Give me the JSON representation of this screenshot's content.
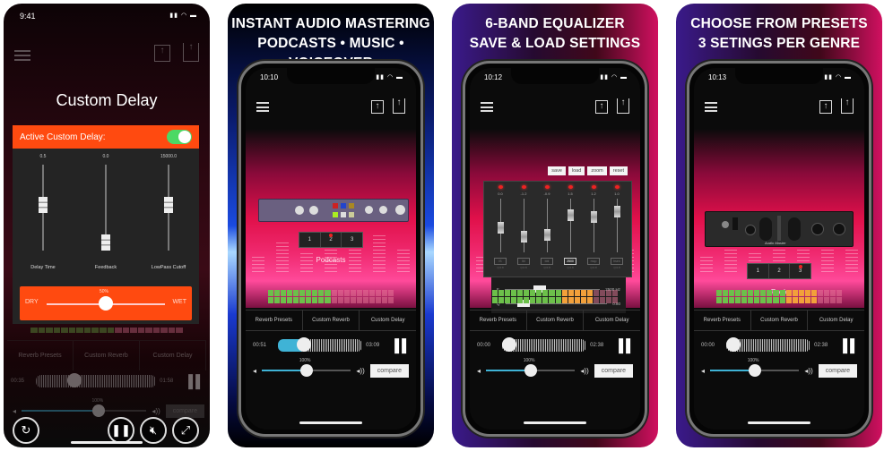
{
  "panels": [
    {
      "status_time": "9:41",
      "dialog_title": "Custom Delay",
      "active_label": "Active Custom Delay:",
      "active_on": true,
      "sliders": [
        {
          "label": "Delay Time",
          "value": "0.5"
        },
        {
          "label": "Feedback",
          "value": "0.0"
        },
        {
          "label": "LowPass Cutoff",
          "value": "15000.0"
        }
      ],
      "mix": {
        "left": "DRY",
        "right": "WET",
        "percent": "50%"
      },
      "tabs": [
        "Reverb Presets",
        "Custom Reverb",
        "Custom Delay"
      ],
      "time_elapsed": "00:35",
      "time_total": "01:58",
      "volume_percent": "100%",
      "compare_label": "compare",
      "controls": [
        "reset-icon",
        "pause-icon",
        "mute-icon",
        "expand-icon"
      ]
    },
    {
      "headline": [
        "INSTANT AUDIO MASTERING",
        "PODCASTS • MUSIC • VOICEOVER"
      ],
      "status_time": "10:10",
      "presets": [
        "1",
        "2",
        "3"
      ],
      "selected_preset": "2",
      "genre": "Podcasts",
      "tabs": [
        "Reverb Presets",
        "Custom Reverb",
        "Custom Delay"
      ],
      "time_elapsed": "00:51",
      "time_total": "03:09",
      "volume_percent": "100%",
      "compare_label": "compare"
    },
    {
      "headline": [
        "6-BAND EQUALIZER",
        "SAVE & LOAD SETTINGS"
      ],
      "status_time": "10:12",
      "eq_buttons": [
        "save",
        "load",
        "zoom",
        "reset"
      ],
      "bands": [
        {
          "value": "0.0",
          "type": "lS",
          "q": "Q:0.8"
        },
        {
          "value": "-1.2",
          "type": "lbl",
          "q": "Q:0.8"
        },
        {
          "value": "-0.9",
          "type": "bbl",
          "q": "Q:0.8"
        },
        {
          "value": "1.5",
          "type": "2500",
          "q": "Q:0.8",
          "active": true
        },
        {
          "value": "1.2",
          "type": "mop",
          "q": "Q:0.8"
        },
        {
          "value": "1.0",
          "type": "hsen",
          "q": "Q:0.8"
        }
      ],
      "freq_label": "F",
      "freq_value": "2500 Hz",
      "q_label": "Q",
      "q_value": "0.80",
      "tabs": [
        "Reverb Presets",
        "Custom Reverb",
        "Custom Delay"
      ],
      "time_elapsed": "00:00",
      "time_total": "02:38",
      "volume_percent": "100%",
      "compare_label": "compare"
    },
    {
      "headline": [
        "CHOOSE FROM PRESETS",
        "3 SETINGS PER GENRE"
      ],
      "status_time": "10:13",
      "presets": [
        "1",
        "2",
        "3"
      ],
      "selected_preset": "3",
      "genre": "Rock",
      "rack_label": "Audio Master",
      "tabs": [
        "Reverb Presets",
        "Custom Reverb",
        "Custom Delay"
      ],
      "time_elapsed": "00:00",
      "time_total": "02:38",
      "volume_percent": "100%",
      "compare_label": "compare"
    }
  ],
  "colors": {
    "accent_orange": "#ff4a10",
    "toggle_on": "#4cd964",
    "volume_fill": "#3fb3d6",
    "meter_green": "#6cc04a",
    "meter_orange": "#f2a03a",
    "meter_off": "#e77a9a"
  }
}
